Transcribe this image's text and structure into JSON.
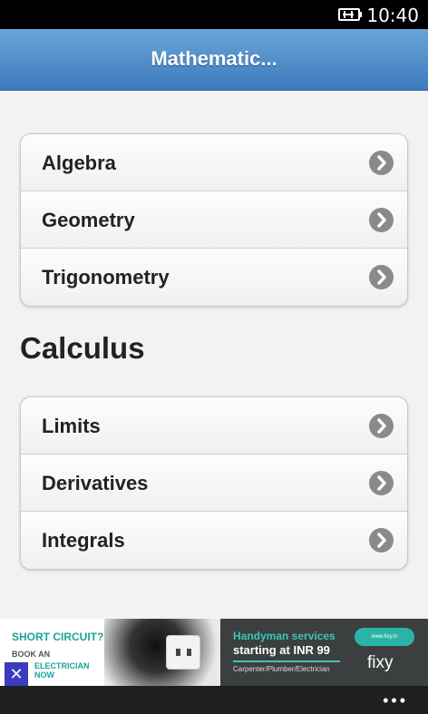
{
  "status_bar": {
    "time": "10:40",
    "battery_icon": "battery-charging-icon"
  },
  "header": {
    "title": "Mathematic..."
  },
  "topics_group": {
    "items": [
      {
        "label": "Algebra",
        "icon": "chevron-right-icon"
      },
      {
        "label": "Geometry",
        "icon": "chevron-right-icon"
      },
      {
        "label": "Trigonometry",
        "icon": "chevron-right-icon"
      }
    ]
  },
  "calculus": {
    "heading": "Calculus",
    "items": [
      {
        "label": "Limits",
        "icon": "chevron-right-icon"
      },
      {
        "label": "Derivatives",
        "icon": "chevron-right-icon"
      },
      {
        "label": "Integrals",
        "icon": "chevron-right-icon"
      }
    ]
  },
  "ad": {
    "left_headline": "SHORT CIRCUIT?",
    "left_line1": "BOOK AN",
    "left_line2": "ELECTRICIAN NOW",
    "close_label": "✕",
    "right_line1": "Handyman services",
    "right_line2": "starting at INR 99",
    "right_line3": "Carpenter/Plumber/Electrician",
    "pill_text": "www.fixy.in",
    "brand": "fixy"
  },
  "app_bar": {
    "more_label": "•••"
  },
  "colors": {
    "header_top": "#6ba4d8",
    "header_bottom": "#3d7bbd",
    "chevron": "#8a8a8a",
    "ad_accent": "#3cc6b8"
  }
}
